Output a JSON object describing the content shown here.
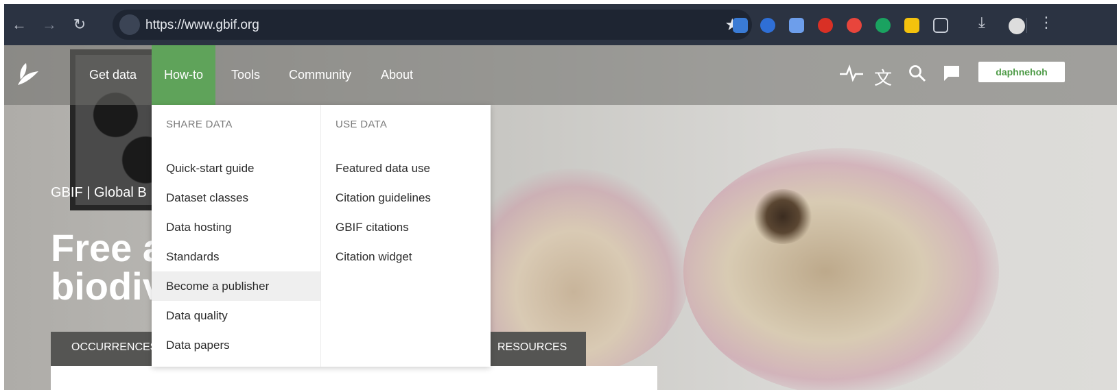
{
  "browser": {
    "url": "https://www.gbif.org",
    "nav_icons": {
      "back": "arrow-left-icon",
      "forward": "arrow-right-icon",
      "reload": "reload-icon"
    }
  },
  "nav": {
    "items": [
      "Get data",
      "How-to",
      "Tools",
      "Community",
      "About"
    ],
    "active": "How-to",
    "user": "daphnehoh"
  },
  "hero": {
    "brand": "GBIF | Global B",
    "title_line1": "Free a",
    "title_line2": "biodiv",
    "tab_left": "OCCURRENCES",
    "tab_right": "RESOURCES"
  },
  "dropdown": {
    "share": {
      "heading": "SHARE DATA",
      "items": [
        "Quick-start guide",
        "Dataset classes",
        "Data hosting",
        "Standards",
        "Become a publisher",
        "Data quality",
        "Data papers"
      ]
    },
    "use": {
      "heading": "USE DATA",
      "items": [
        "Featured data use",
        "Citation guidelines",
        "GBIF citations",
        "Citation widget"
      ]
    },
    "hovered": "Become a publisher"
  },
  "colors": {
    "accent_green": "#5fa35a",
    "chrome_bg": "#2b3342",
    "user_text": "#4e9b47"
  }
}
